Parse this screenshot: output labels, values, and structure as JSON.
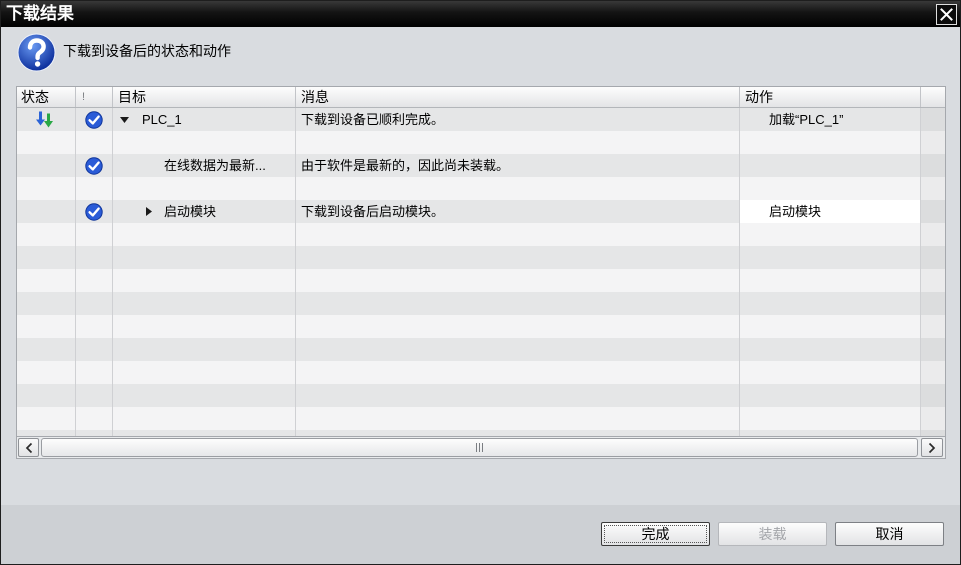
{
  "colors": {
    "title_bar": "#000000",
    "accent_blue": "#2a5bd7",
    "download_green": "#2aa846",
    "dialog_background": "#d9dce0"
  },
  "window": {
    "title": "下载结果",
    "close_icon": "close-icon"
  },
  "header": {
    "icon": "question-icon",
    "message": "下载到设备后的状态和动作"
  },
  "table": {
    "columns": {
      "status": "状态",
      "severity": "!",
      "target": "目标",
      "message": "消息",
      "action": "动作"
    },
    "rows": [
      {
        "status_icon": "download-icon",
        "result_icon": "check-circle-icon",
        "depth": 0,
        "expander_icon": "triangle-down-icon",
        "target": "PLC_1",
        "message": "下载到设备已顺利完成。",
        "action": "加载“PLC_1”"
      },
      {
        "target": "",
        "message": "",
        "action": ""
      },
      {
        "result_icon": "check-circle-icon",
        "depth": 1,
        "target": "在线数据为最新...",
        "message": "由于软件是最新的，因此尚未装载。",
        "action": ""
      },
      {
        "target": "",
        "message": "",
        "action": ""
      },
      {
        "result_icon": "check-circle-icon",
        "depth": 1,
        "expander_icon": "triangle-right-icon",
        "target": "启动模块",
        "message": "下载到设备后启动模块。",
        "action": "启动模块",
        "action_selectable": true
      }
    ]
  },
  "scrollbar": {
    "left_icon": "chevron-left-icon",
    "grip_icon": "scroll-grip-icon",
    "right_icon": "chevron-right-icon"
  },
  "buttons": {
    "finish": {
      "label": "完成",
      "enabled": true,
      "focused": true
    },
    "load": {
      "label": "装载",
      "enabled": false
    },
    "cancel": {
      "label": "取消",
      "enabled": true
    }
  }
}
